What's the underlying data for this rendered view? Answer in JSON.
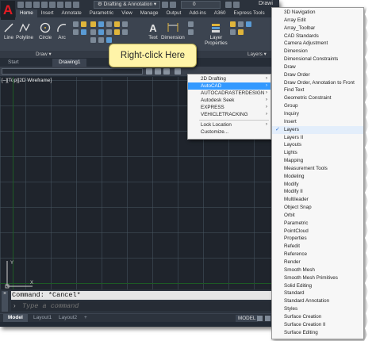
{
  "app": {
    "logo_letter": "A",
    "workspace": "Drafting & Annotation",
    "layer_value": "0",
    "document_title": "Drawi",
    "accent": "#e31b23"
  },
  "ribbon": {
    "tabs": [
      {
        "label": "Home",
        "active": true
      },
      {
        "label": "Insert",
        "active": false
      },
      {
        "label": "Annotate",
        "active": false
      },
      {
        "label": "Parametric",
        "active": false
      },
      {
        "label": "View",
        "active": false
      },
      {
        "label": "Manage",
        "active": false
      },
      {
        "label": "Output",
        "active": false
      },
      {
        "label": "Add-ins",
        "active": false
      },
      {
        "label": "A360",
        "active": false
      },
      {
        "label": "Express Tools",
        "active": false
      },
      {
        "label": "Fe",
        "active": false
      }
    ],
    "tools": {
      "line": "Line",
      "polyline": "Polyline",
      "circle": "Circle",
      "arc": "Arc",
      "text": "Text",
      "dimension": "Dimension",
      "layer_properties_1": "Layer",
      "layer_properties_2": "Properties"
    },
    "panel_titles": {
      "draw": "Draw ▾",
      "layers": "Layers ▾"
    }
  },
  "file_tabs": {
    "start": "Start",
    "drawing": "Drawing1"
  },
  "viewport": {
    "label": "[–][Top][2D Wireframe]"
  },
  "callout": {
    "text": "Right-click Here"
  },
  "context_menu": {
    "items": [
      {
        "label": "2D Drafting",
        "arrow": "›"
      },
      {
        "label": "AutoCAD",
        "arrow": "›"
      },
      {
        "label": "AUTOCADRASTERDESIGN",
        "arrow": "›"
      },
      {
        "label": "Autodesk Seek",
        "arrow": "›"
      },
      {
        "label": "EXPRESS",
        "arrow": "›"
      },
      {
        "label": "VEHICLETRACKING",
        "arrow": "›"
      },
      {
        "label": "Lock Location",
        "arrow": "›"
      },
      {
        "label": "Customize...",
        "arrow": ""
      }
    ],
    "highlighted_index": 1
  },
  "toolbar_list": {
    "items": [
      "3D Navigation",
      "Array Edit",
      "Array_Toolbar",
      "CAD Standards",
      "Camera Adjustment",
      "Dimension",
      "Dimensional Constraints",
      "Draw",
      "Draw Order",
      "Draw Order, Annotation to Front",
      "Find Text",
      "Geometric Constraint",
      "Group",
      "Inquiry",
      "Insert",
      "Layers",
      "Layers II",
      "Layouts",
      "Lights",
      "Mapping",
      "Measurement Tools",
      "Modeling",
      "Modify",
      "Modify II",
      "Multileader",
      "Object Snap",
      "Orbit",
      "Parametric",
      "PointCloud",
      "Properties",
      "Refedit",
      "Reference",
      "Render",
      "Smooth Mesh",
      "Smooth Mesh Primitives",
      "Solid Editing",
      "Standard",
      "Standard Annotation",
      "Styles",
      "Surface Creation",
      "Surface Creation II",
      "Surface Editing"
    ],
    "checked_item": "Layers",
    "check_glyph": "✓"
  },
  "command_line": {
    "history": "Command: *Cancel*",
    "placeholder": "Type a command",
    "close_glyph": "×"
  },
  "status_bar": {
    "tabs": [
      {
        "label": "Model",
        "active": true
      },
      {
        "label": "Layout1",
        "active": false
      },
      {
        "label": "Layout2",
        "active": false
      },
      {
        "label": "+",
        "active": false
      }
    ],
    "mode": "MODEL"
  }
}
